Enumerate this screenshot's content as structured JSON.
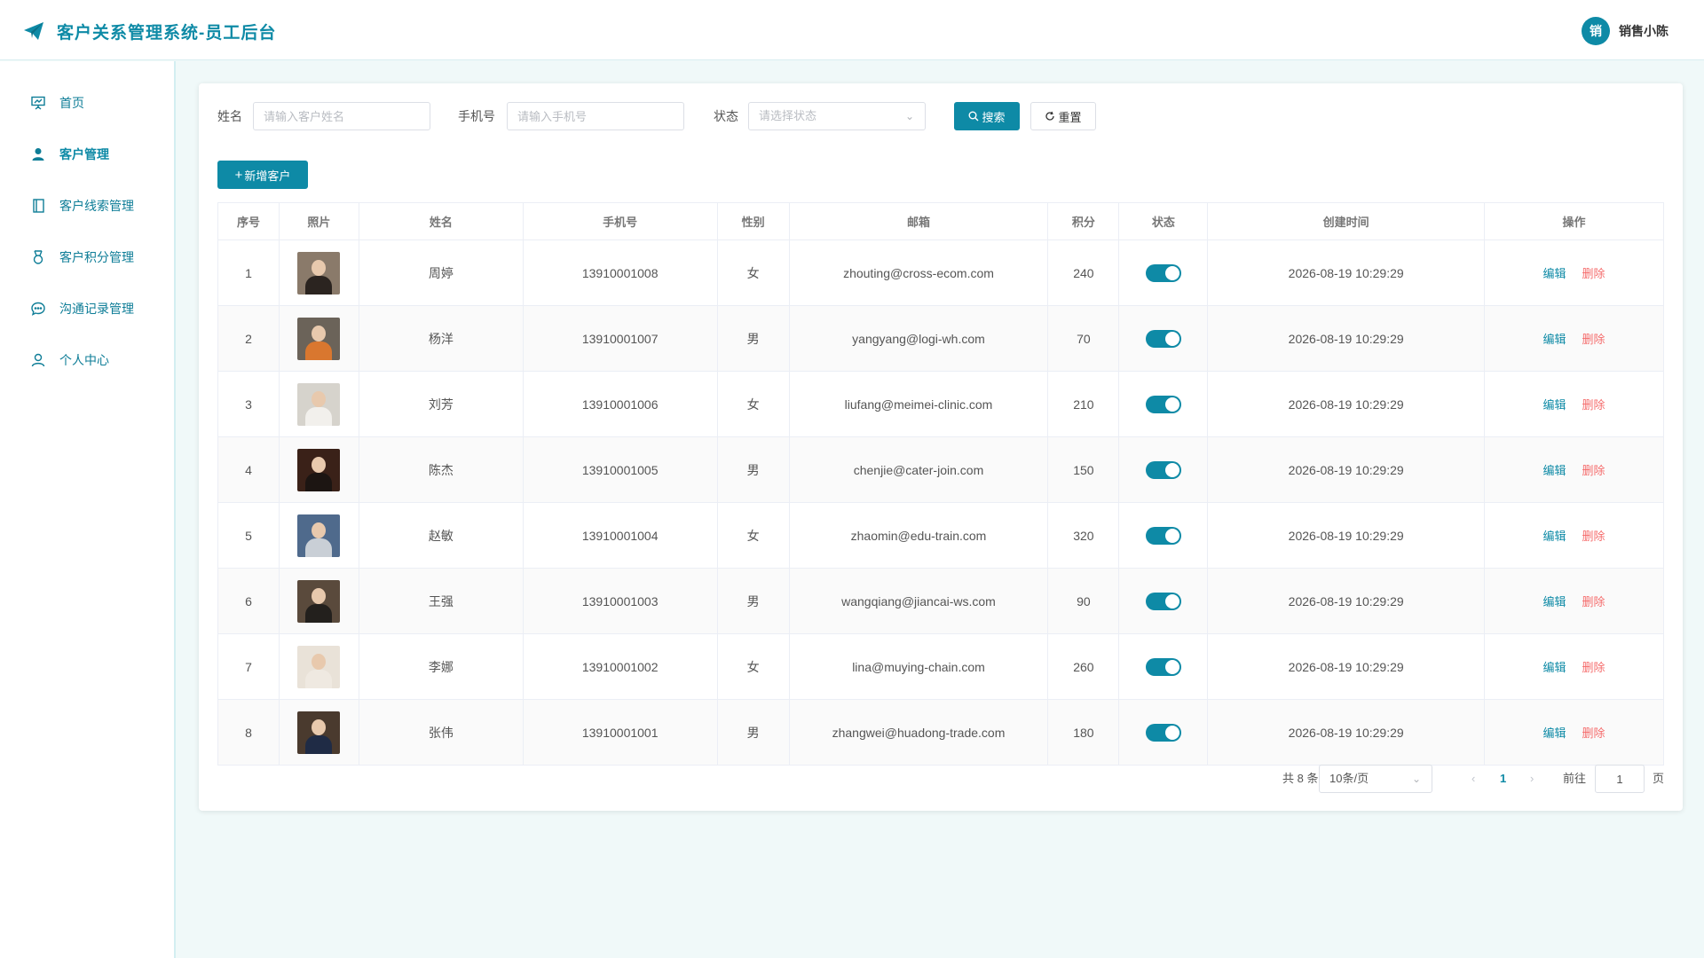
{
  "header": {
    "title": "客户关系管理系统-员工后台",
    "avatar_text": "销",
    "user_name": "销售小陈"
  },
  "sidebar": {
    "items": [
      {
        "label": "首页",
        "icon": "presentation-chart-icon"
      },
      {
        "label": "客户管理",
        "icon": "user-solid-icon"
      },
      {
        "label": "客户线索管理",
        "icon": "notebook-icon"
      },
      {
        "label": "客户积分管理",
        "icon": "medal-icon"
      },
      {
        "label": "沟通记录管理",
        "icon": "chat-bubble-icon"
      },
      {
        "label": "个人中心",
        "icon": "user-outline-icon"
      }
    ],
    "active_index": 1
  },
  "search": {
    "name_label": "姓名",
    "name_placeholder": "请输入客户姓名",
    "phone_label": "手机号",
    "phone_placeholder": "请输入手机号",
    "status_label": "状态",
    "status_placeholder": "请选择状态",
    "search_button": "搜索",
    "reset_button": "重置"
  },
  "toolbar": {
    "add_button": "新增客户"
  },
  "table": {
    "columns": [
      "序号",
      "照片",
      "姓名",
      "手机号",
      "性别",
      "邮箱",
      "积分",
      "状态",
      "创建时间",
      "操作"
    ],
    "edit_label": "编辑",
    "delete_label": "删除",
    "rows": [
      {
        "index": "1",
        "name": "周婷",
        "phone": "13910001008",
        "gender": "女",
        "email": "zhouting@cross-ecom.com",
        "points": "240",
        "status_on": true,
        "created": "2026-08-19 10:29:29",
        "photo_bg": "#8a7a6a",
        "photo_fg": "#2b2420"
      },
      {
        "index": "2",
        "name": "杨洋",
        "phone": "13910001007",
        "gender": "男",
        "email": "yangyang@logi-wh.com",
        "points": "70",
        "status_on": true,
        "created": "2026-08-19 10:29:29",
        "photo_bg": "#6b6359",
        "photo_fg": "#d9772f"
      },
      {
        "index": "3",
        "name": "刘芳",
        "phone": "13910001006",
        "gender": "女",
        "email": "liufang@meimei-clinic.com",
        "points": "210",
        "status_on": true,
        "created": "2026-08-19 10:29:29",
        "photo_bg": "#d6d3cc",
        "photo_fg": "#f2f0ec"
      },
      {
        "index": "4",
        "name": "陈杰",
        "phone": "13910001005",
        "gender": "男",
        "email": "chenjie@cater-join.com",
        "points": "150",
        "status_on": true,
        "created": "2026-08-19 10:29:29",
        "photo_bg": "#3a2118",
        "photo_fg": "#1c1512"
      },
      {
        "index": "5",
        "name": "赵敏",
        "phone": "13910001004",
        "gender": "女",
        "email": "zhaomin@edu-train.com",
        "points": "320",
        "status_on": true,
        "created": "2026-08-19 10:29:29",
        "photo_bg": "#4f6a8c",
        "photo_fg": "#c9cfd6"
      },
      {
        "index": "6",
        "name": "王强",
        "phone": "13910001003",
        "gender": "男",
        "email": "wangqiang@jiancai-ws.com",
        "points": "90",
        "status_on": true,
        "created": "2026-08-19 10:29:29",
        "photo_bg": "#5a4a3c",
        "photo_fg": "#23201d"
      },
      {
        "index": "7",
        "name": "李娜",
        "phone": "13910001002",
        "gender": "女",
        "email": "lina@muying-chain.com",
        "points": "260",
        "status_on": true,
        "created": "2026-08-19 10:29:29",
        "photo_bg": "#e9e2d8",
        "photo_fg": "#efe9e1"
      },
      {
        "index": "8",
        "name": "张伟",
        "phone": "13910001001",
        "gender": "男",
        "email": "zhangwei@huadong-trade.com",
        "points": "180",
        "status_on": true,
        "created": "2026-08-19 10:29:29",
        "photo_bg": "#4a3a2e",
        "photo_fg": "#1f2b45"
      }
    ]
  },
  "pagination": {
    "total_text": "共 8 条",
    "page_size": "10条/页",
    "current_page": "1",
    "goto_label": "前往",
    "goto_value": "1",
    "page_suffix": "页"
  },
  "colors": {
    "accent": "#0e8aa6",
    "danger": "#f56c6c",
    "background": "#f0f9f9"
  }
}
